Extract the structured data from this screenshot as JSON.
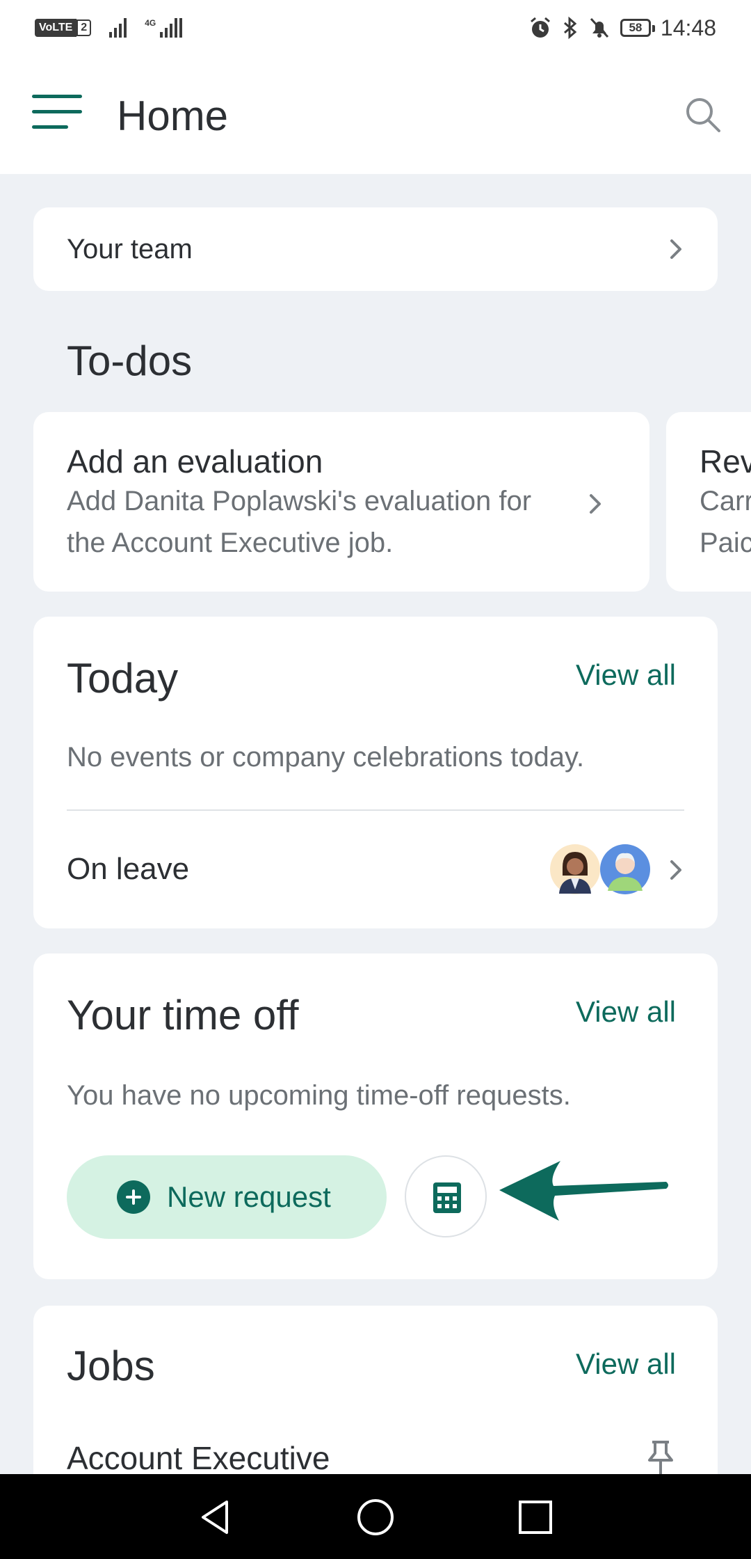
{
  "status_bar": {
    "volte": "VoLTE",
    "sim": "2",
    "network": "4G",
    "battery": "58",
    "time": "14:48"
  },
  "app_bar": {
    "title": "Home"
  },
  "your_team": {
    "label": "Your team"
  },
  "todos": {
    "heading": "To-dos",
    "cards": [
      {
        "title": "Add an evaluation",
        "line1": "Add Danita Poplawski's evaluation for",
        "line2": "the Account Executive job."
      },
      {
        "title": "Rev",
        "line1": "Carr",
        "line2": "Paic"
      }
    ]
  },
  "today": {
    "heading": "Today",
    "view_all": "View all",
    "empty_message": "No events or company celebrations today.",
    "on_leave_label": "On leave"
  },
  "time_off": {
    "heading": "Your time off",
    "view_all": "View all",
    "empty_message": "You have no upcoming time-off requests.",
    "new_request_label": "New request"
  },
  "jobs": {
    "heading": "Jobs",
    "view_all": "View all",
    "first_job": "Account Executive"
  },
  "colors": {
    "accent": "#0d6a5c",
    "pill_bg": "#d5f2e3",
    "background": "#eef1f5",
    "text": "#2c2f33",
    "muted_text": "#6b7075"
  },
  "icons": {
    "menu": "menu-icon",
    "search": "search-icon",
    "chevron": "chevron-right-icon",
    "plus": "plus-circle-icon",
    "calculator": "calculator-icon",
    "pin": "pin-icon",
    "annotation": "arrow-left-icon"
  }
}
